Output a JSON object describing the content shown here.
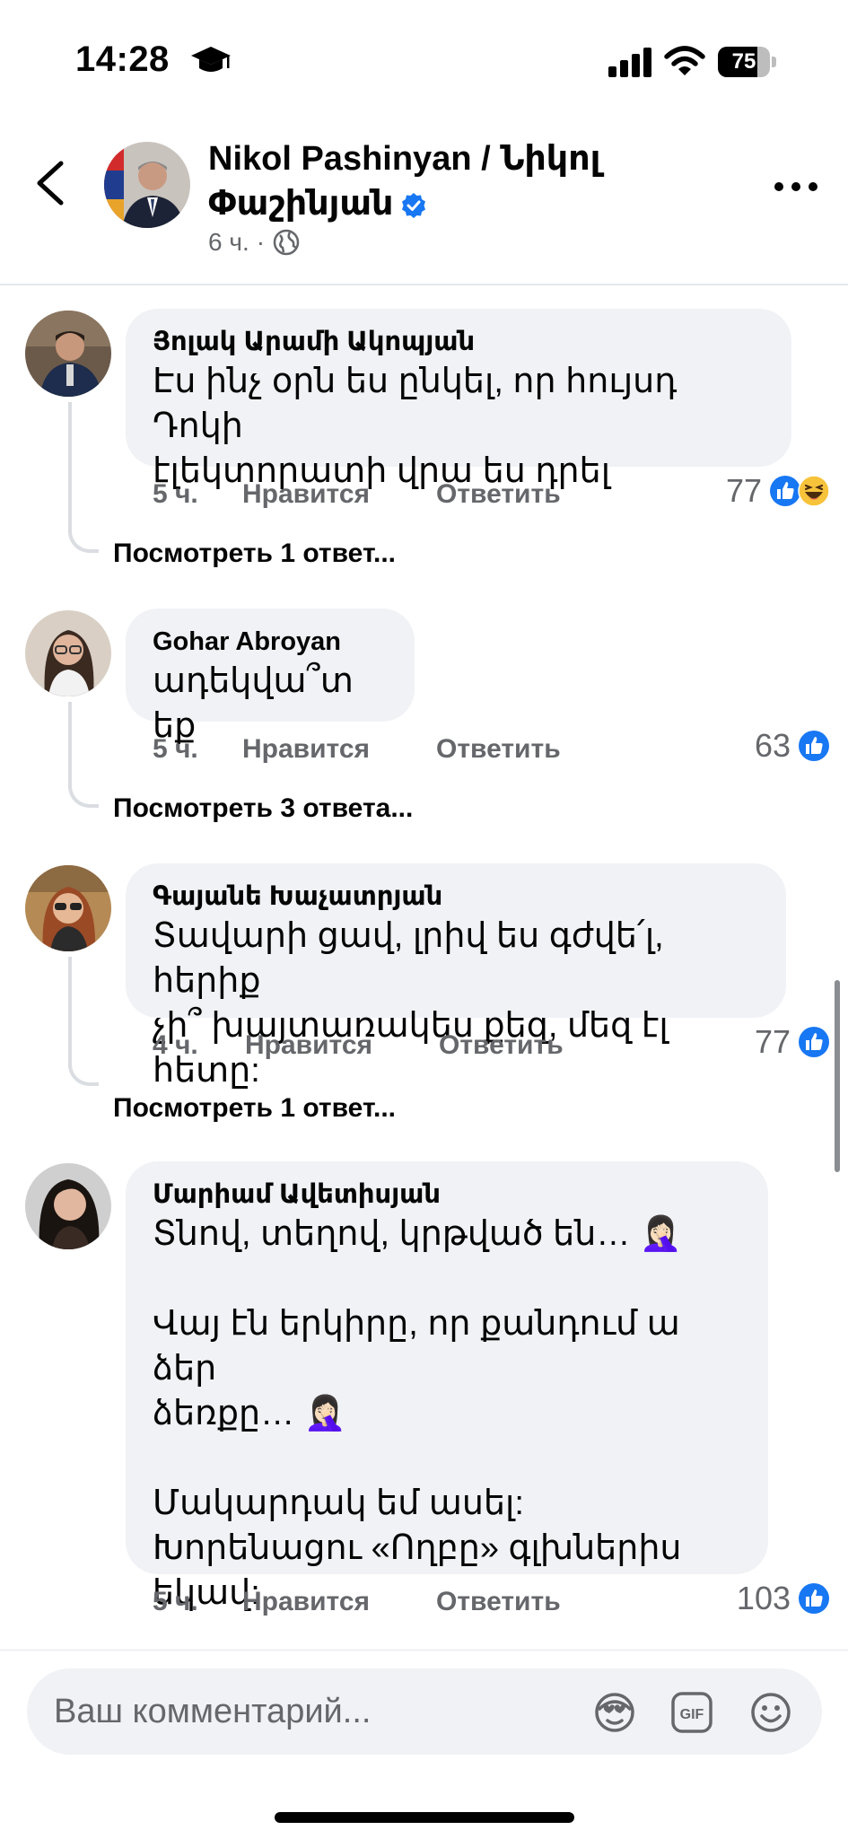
{
  "status": {
    "time": "14:28",
    "battery": "75",
    "battery_level": 0.75
  },
  "post": {
    "author": "Nikol Pashinyan / Նիկոլ Փաշինյան",
    "time": "6 ч.",
    "separator": "·",
    "icons": {
      "back": "chevron-left-icon",
      "more": "more-dots-icon",
      "verified": "verified-badge-icon",
      "audience": "globe-icon"
    }
  },
  "labels": {
    "like": "Нравится",
    "reply": "Ответить"
  },
  "comments": [
    {
      "author": "Յոլակ Արամի Ակոպյան",
      "text": "Էս ինչ օրն ես ընկել, որ հույսդ Դոկի\nէլեկտորատի վրա ես դրել",
      "time": "5 ч.",
      "reactions": "77",
      "reaction_icons": [
        "like-reaction-icon",
        "haha-reaction-icon"
      ],
      "view_replies": "Посмотреть 1 ответ..."
    },
    {
      "author": "Gohar Abroyan",
      "text": "ադեկվա՞տ եք",
      "time": "5 ч.",
      "reactions": "63",
      "reaction_icons": [
        "like-reaction-icon"
      ],
      "view_replies": "Посмотреть 3 ответа..."
    },
    {
      "author": "Գայանե Խաչատրյան",
      "text": "Տավարի ցավ, լրիվ ես գժվե՛լ, հերիք\nչի՞ խայտառակես քեզ, մեզ էլ հետը:",
      "time": "4 ч.",
      "reactions": "77",
      "reaction_icons": [
        "like-reaction-icon"
      ],
      "view_replies": "Посмотреть 1 ответ..."
    },
    {
      "author": "Մարիամ Ավետիսյան",
      "text": "Տնով, տեղով, կրթված են… 🤦🏻‍♀️\n\nՎայ էն երկիրը, որ քանդում ա ձեր\nձեռքը… 🤦🏻‍♀️\n\nՄակարդակ եմ ասել:\nԽորենացու «Ողբը» գլխներիս\nեկավ:",
      "time": "5 ч.",
      "reactions": "103",
      "reaction_icons": [
        "like-reaction-icon"
      ]
    }
  ],
  "composer": {
    "placeholder": "Ваш комментарий...",
    "icons": [
      "avatar-sticker-icon",
      "gif-icon",
      "emoji-icon"
    ]
  },
  "colors": {
    "like_blue": "#1877f2",
    "bubble": "#f0f2f5",
    "secondary_text": "#65676b"
  }
}
